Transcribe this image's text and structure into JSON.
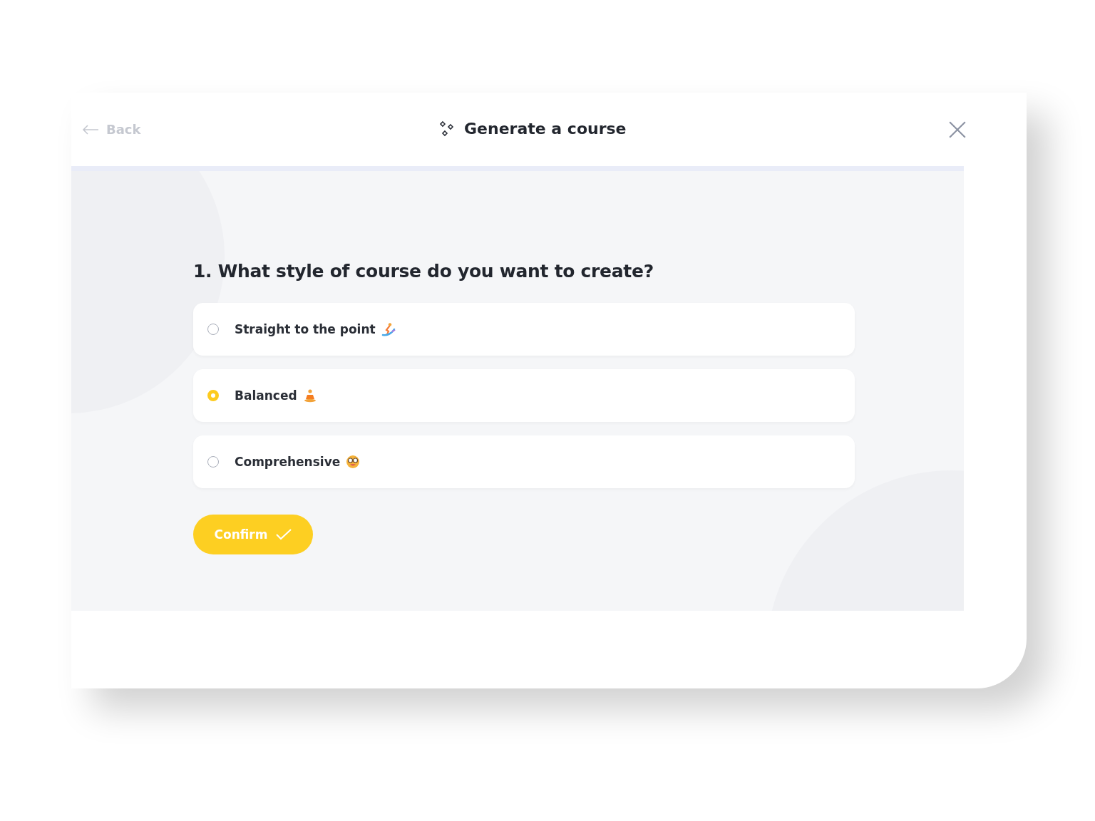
{
  "header": {
    "back": "Back",
    "title": "Generate a course"
  },
  "question": "1. What style of course do you want to create?",
  "options": [
    {
      "label": "Straight to the point",
      "kind": "surfer",
      "selected": false
    },
    {
      "label": "Balanced",
      "kind": "meditating",
      "selected": true
    },
    {
      "label": "Comprehensive",
      "kind": "glasses",
      "selected": false
    }
  ],
  "confirm": "Confirm"
}
